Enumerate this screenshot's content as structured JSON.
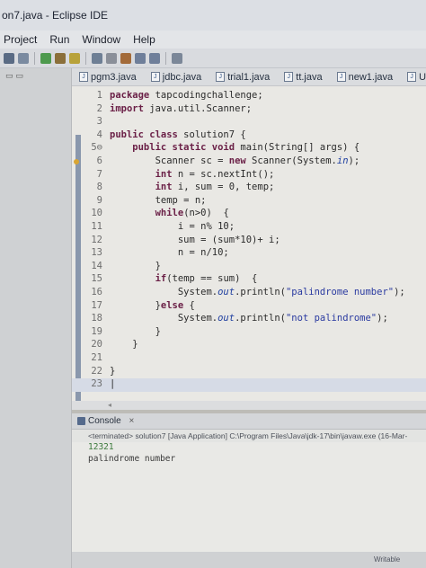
{
  "window": {
    "title": "on7.java - Eclipse IDE"
  },
  "menu": {
    "items": [
      "Project",
      "Run",
      "Window",
      "Help"
    ]
  },
  "editor_tabs": [
    "pgm3.java",
    "jdbc.java",
    "trial1.java",
    "tt.java",
    "new1.java",
    "Upc"
  ],
  "code_lines": [
    {
      "num": "1",
      "parts": [
        {
          "t": "package",
          "c": "kw"
        },
        {
          "t": " tapcodingchallenge;",
          "c": ""
        }
      ]
    },
    {
      "num": "2",
      "parts": [
        {
          "t": "import",
          "c": "kw"
        },
        {
          "t": " java.util.Scanner;",
          "c": ""
        }
      ]
    },
    {
      "num": "3",
      "parts": []
    },
    {
      "num": "4",
      "parts": [
        {
          "t": "public class",
          "c": "kw"
        },
        {
          "t": " solution7 {",
          "c": ""
        }
      ]
    },
    {
      "num": "5⊖",
      "parts": [
        {
          "t": "    public static void",
          "c": "kw"
        },
        {
          "t": " main(String[] args) {",
          "c": ""
        }
      ]
    },
    {
      "num": "6",
      "parts": [
        {
          "t": "        Scanner sc = ",
          "c": ""
        },
        {
          "t": "new",
          "c": "kw"
        },
        {
          "t": " Scanner(System.",
          "c": ""
        },
        {
          "t": "in",
          "c": "fld"
        },
        {
          "t": ");",
          "c": ""
        }
      ]
    },
    {
      "num": "7",
      "parts": [
        {
          "t": "        ",
          "c": ""
        },
        {
          "t": "int",
          "c": "kw"
        },
        {
          "t": " n = sc.nextInt();",
          "c": ""
        }
      ]
    },
    {
      "num": "8",
      "parts": [
        {
          "t": "        ",
          "c": ""
        },
        {
          "t": "int",
          "c": "kw"
        },
        {
          "t": " i, sum = 0, temp;",
          "c": ""
        }
      ]
    },
    {
      "num": "9",
      "parts": [
        {
          "t": "        temp = n;",
          "c": ""
        }
      ]
    },
    {
      "num": "10",
      "parts": [
        {
          "t": "        ",
          "c": ""
        },
        {
          "t": "while",
          "c": "kw"
        },
        {
          "t": "(n>0)  {",
          "c": ""
        }
      ]
    },
    {
      "num": "11",
      "parts": [
        {
          "t": "            i = n% 10;",
          "c": ""
        }
      ]
    },
    {
      "num": "12",
      "parts": [
        {
          "t": "            sum = (sum*10)+ i;",
          "c": ""
        }
      ]
    },
    {
      "num": "13",
      "parts": [
        {
          "t": "            n = n/10;",
          "c": ""
        }
      ]
    },
    {
      "num": "14",
      "parts": [
        {
          "t": "        }",
          "c": ""
        }
      ]
    },
    {
      "num": "15",
      "parts": [
        {
          "t": "        ",
          "c": ""
        },
        {
          "t": "if",
          "c": "kw"
        },
        {
          "t": "(temp == sum)  {",
          "c": ""
        }
      ]
    },
    {
      "num": "16",
      "parts": [
        {
          "t": "            System.",
          "c": ""
        },
        {
          "t": "out",
          "c": "fld"
        },
        {
          "t": ".println(",
          "c": ""
        },
        {
          "t": "\"palindrome number\"",
          "c": "str"
        },
        {
          "t": ");",
          "c": ""
        }
      ]
    },
    {
      "num": "17",
      "parts": [
        {
          "t": "        }",
          "c": ""
        },
        {
          "t": "else",
          "c": "kw"
        },
        {
          "t": " {",
          "c": ""
        }
      ]
    },
    {
      "num": "18",
      "parts": [
        {
          "t": "            System.",
          "c": ""
        },
        {
          "t": "out",
          "c": "fld"
        },
        {
          "t": ".println(",
          "c": ""
        },
        {
          "t": "\"not palindrome\"",
          "c": "str"
        },
        {
          "t": ");",
          "c": ""
        }
      ]
    },
    {
      "num": "19",
      "parts": [
        {
          "t": "        }",
          "c": ""
        }
      ]
    },
    {
      "num": "20",
      "parts": [
        {
          "t": "    }",
          "c": ""
        }
      ]
    },
    {
      "num": "21",
      "parts": []
    },
    {
      "num": "22",
      "parts": [
        {
          "t": "}",
          "c": ""
        }
      ]
    },
    {
      "num": "23",
      "parts": [
        {
          "t": "|",
          "c": ""
        }
      ]
    }
  ],
  "console": {
    "tab_label": "Console",
    "close_glyph": "×",
    "header": "<terminated> solution7 [Java Application] C:\\Program Files\\Java\\jdk-17\\bin\\javaw.exe  (16-Mar-",
    "input_line": "12321",
    "output_line": "palindrome number"
  },
  "status": {
    "mode": "Writable"
  },
  "colors": {
    "keyword": "#6a1f46",
    "string": "#2a3aa0",
    "field": "#1f3fa0"
  }
}
